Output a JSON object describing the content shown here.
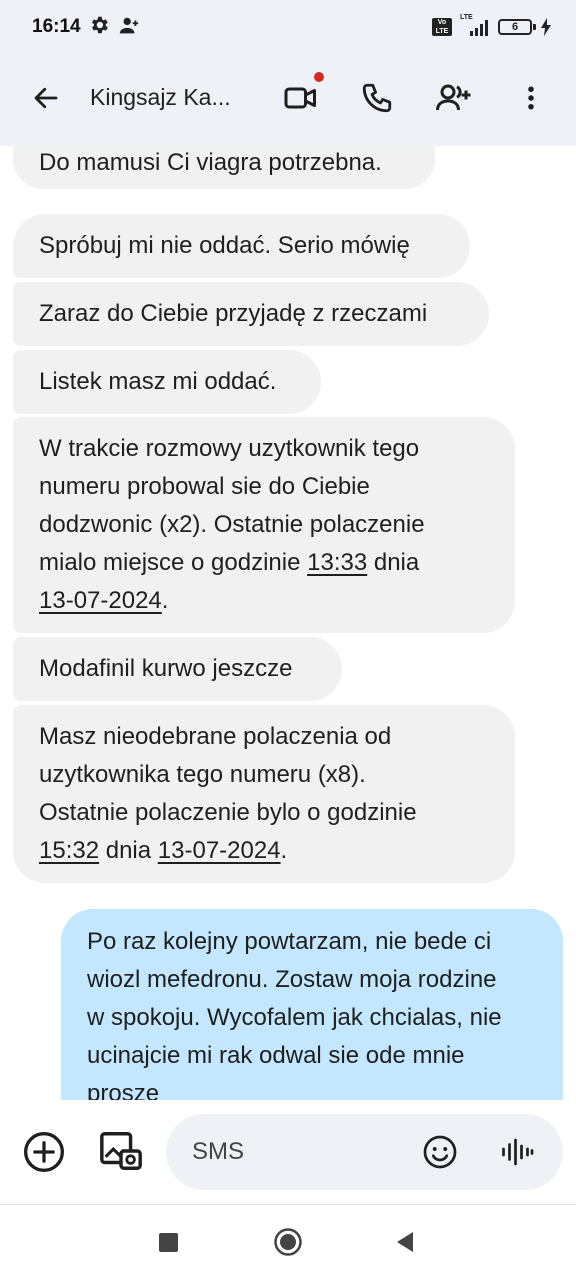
{
  "status_bar": {
    "time": "16:14",
    "volte_label": "Vo\nLTE",
    "lte_label": "LTE",
    "battery_level": "6",
    "icons": [
      "gear-icon",
      "person-add-icon",
      "signal-icon",
      "battery-icon",
      "charging-bolt-icon"
    ]
  },
  "app_bar": {
    "title": "Kingsajz Ka...",
    "icons": [
      "back-arrow-icon",
      "video-call-icon",
      "phone-icon",
      "add-person-icon",
      "more-vert-icon"
    ],
    "video_badge_color": "#d52a1e"
  },
  "messages": [
    {
      "direction": "incoming",
      "lines": [
        "Do mamusi Ci viagra potrzebna."
      ]
    },
    {
      "direction": "incoming",
      "lines": [
        "Spróbuj mi nie oddać. Serio mówię"
      ]
    },
    {
      "direction": "incoming",
      "lines": [
        "Zaraz do Ciebie przyjadę z rzeczami"
      ]
    },
    {
      "direction": "incoming",
      "lines": [
        "Listek masz mi oddać."
      ]
    },
    {
      "direction": "incoming",
      "lines": [
        "W trakcie rozmowy uzytkownik tego",
        "numeru probowal sie do Ciebie",
        "dodzwonic (x2). Ostatnie polaczenie"
      ],
      "line4_prefix": "mialo miejsce o godzinie ",
      "line4_time": "13:33",
      "line4_suffix": " dnia",
      "line5_date": "13-07-2024",
      "line5_suffix": "."
    },
    {
      "direction": "incoming",
      "lines": [
        "Modafinil kurwo jeszcze"
      ]
    },
    {
      "direction": "incoming",
      "lines": [
        "Masz nieodebrane polaczenia od",
        "uzytkownika tego numeru (x8).",
        "Ostatnie polaczenie bylo o godzinie"
      ],
      "line4_time": "15:32",
      "line4_mid": " dnia ",
      "line4_date": "13-07-2024",
      "line4_suffix": "."
    },
    {
      "direction": "outgoing",
      "lines": [
        "Po raz kolejny powtarzam, nie bede ci",
        "wiozl mefedronu. Zostaw moja rodzine",
        "w spokoju. Wycofalem jak chcialas, nie",
        "ucinajcie mi rak odwal sie ode mnie",
        "prosze"
      ]
    }
  ],
  "colors": {
    "incoming_bubble": "#f1f1f1",
    "outgoing_bubble": "#c2e7ff",
    "header_bg": "#eef1f7"
  },
  "compose": {
    "placeholder": "SMS",
    "icons": [
      "add-circle-icon",
      "gallery-icon",
      "emoji-icon",
      "voice-icon"
    ]
  },
  "nav_bar": {
    "icons": [
      "recents-square-icon",
      "home-circle-icon",
      "back-triangle-icon"
    ]
  }
}
